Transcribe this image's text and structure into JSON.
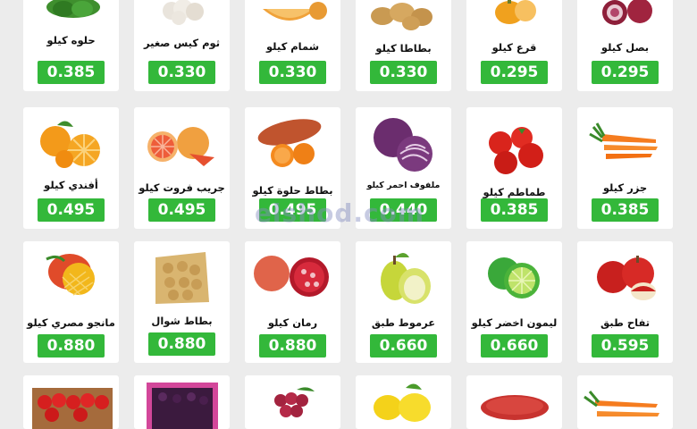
{
  "watermark": "elshod.com",
  "products": [
    {
      "name": "حلوه كيلو",
      "price": "0.385",
      "icon": "vegetable-icon"
    },
    {
      "name": "ثوم كيس صغير",
      "price": "0.330",
      "icon": "garlic-icon"
    },
    {
      "name": "شمام كيلو",
      "price": "0.330",
      "icon": "cantaloupe-icon"
    },
    {
      "name": "بطاطا كيلو",
      "price": "0.330",
      "icon": "potato-icon"
    },
    {
      "name": "قرع كيلو",
      "price": "0.295",
      "icon": "pumpkin-icon"
    },
    {
      "name": "بصل كيلو",
      "price": "0.295",
      "icon": "onion-icon"
    },
    {
      "name": "أفندي كيلو",
      "price": "0.495",
      "icon": "tangerine-icon"
    },
    {
      "name": "جريب فروت كيلو",
      "price": "0.495",
      "icon": "grapefruit-icon"
    },
    {
      "name": "بطاط حلوة كيلو",
      "price": "0.495",
      "icon": "sweet-potato-icon"
    },
    {
      "name": "ملفوف احمر كيلو",
      "price": "0.440",
      "icon": "red-cabbage-icon"
    },
    {
      "name": "طماطم كيلو",
      "price": "0.385",
      "icon": "tomato-icon"
    },
    {
      "name": "جزر كيلو",
      "price": "0.385",
      "icon": "carrot-icon"
    },
    {
      "name": "مانجو مصري كيلو",
      "price": "0.880",
      "icon": "mango-icon"
    },
    {
      "name": "بطاط شوال",
      "price": "0.880",
      "icon": "potato-sack-icon"
    },
    {
      "name": "رمان كيلو",
      "price": "0.880",
      "icon": "pomegranate-icon"
    },
    {
      "name": "عرموط طبق",
      "price": "0.660",
      "icon": "pear-icon"
    },
    {
      "name": "ليمون اخضر كيلو",
      "price": "0.660",
      "icon": "lime-icon"
    },
    {
      "name": "تفاح طبق",
      "price": "0.595",
      "icon": "apple-icon"
    },
    {
      "name": "",
      "price": "",
      "icon": "strawberry-box-icon"
    },
    {
      "name": "",
      "price": "",
      "icon": "berries-box-icon"
    },
    {
      "name": "",
      "price": "",
      "icon": "grapes-icon"
    },
    {
      "name": "",
      "price": "",
      "icon": "lemon-icon"
    },
    {
      "name": "",
      "price": "",
      "icon": "sweet-potato-icon"
    },
    {
      "name": "",
      "price": "",
      "icon": "carrot-icon"
    }
  ]
}
